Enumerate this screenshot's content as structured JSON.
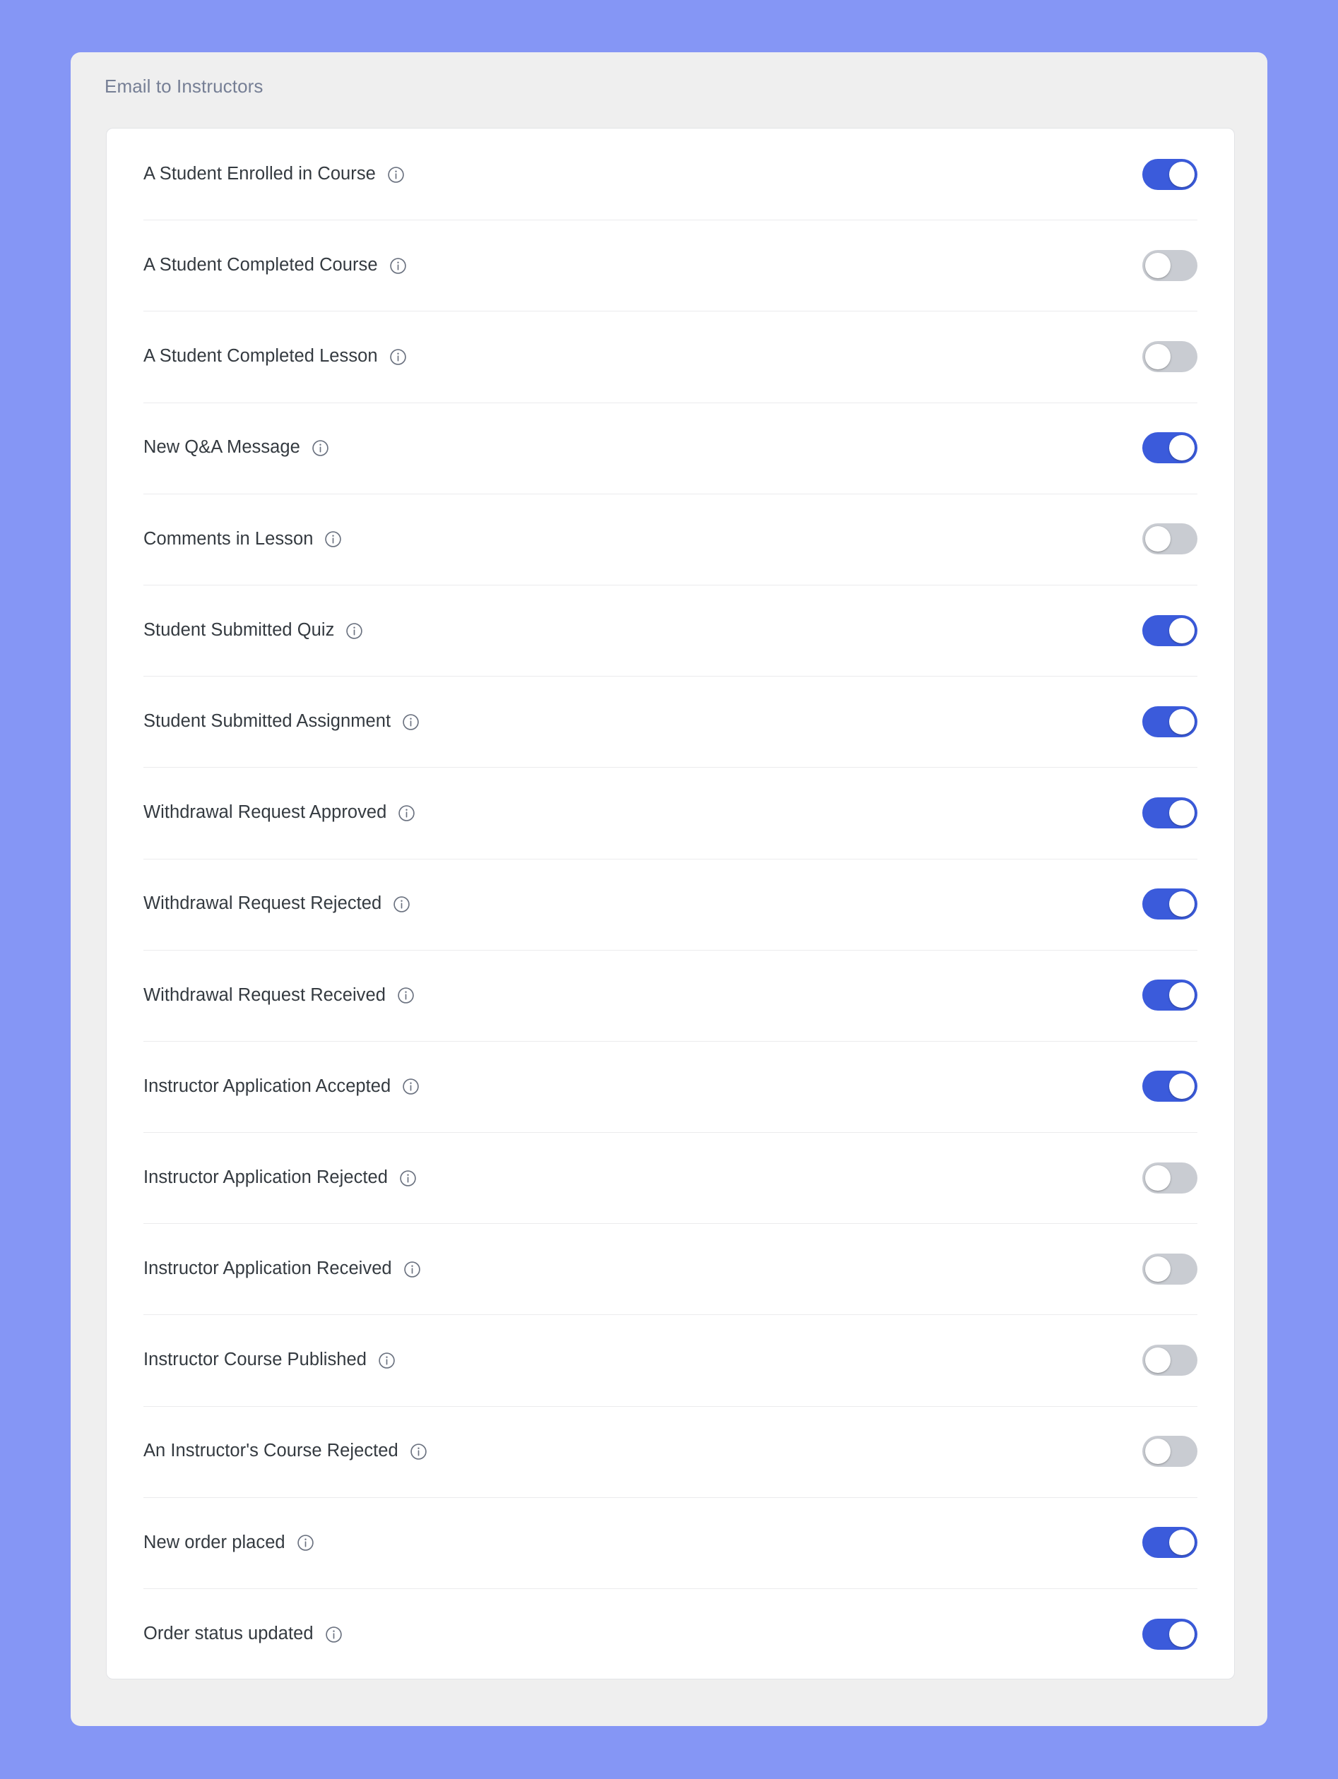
{
  "theme": {
    "page_background": "#8596F5",
    "panel_background": "#EFEFEF",
    "card_background": "#FFFFFF",
    "toggle_on_color": "#3B5BDB",
    "toggle_off_color": "#C9CCD2",
    "label_color": "#343A40",
    "header_color": "#767F95",
    "divider_color": "#EBEBED"
  },
  "section": {
    "title": "Email to Instructors"
  },
  "icons": {
    "info": "info-circle-icon"
  },
  "settings": [
    {
      "label": "A Student Enrolled in Course",
      "enabled": true,
      "state_text": "On"
    },
    {
      "label": "A Student Completed Course",
      "enabled": false,
      "state_text": "Off"
    },
    {
      "label": "A Student Completed Lesson",
      "enabled": false,
      "state_text": "Off"
    },
    {
      "label": "New Q&A Message",
      "enabled": true,
      "state_text": "On"
    },
    {
      "label": "Comments in Lesson",
      "enabled": false,
      "state_text": "Off"
    },
    {
      "label": "Student Submitted Quiz",
      "enabled": true,
      "state_text": "On"
    },
    {
      "label": "Student Submitted Assignment",
      "enabled": true,
      "state_text": "On"
    },
    {
      "label": "Withdrawal Request Approved",
      "enabled": true,
      "state_text": "On"
    },
    {
      "label": "Withdrawal Request Rejected",
      "enabled": true,
      "state_text": "On"
    },
    {
      "label": "Withdrawal Request Received",
      "enabled": true,
      "state_text": "On"
    },
    {
      "label": "Instructor Application Accepted",
      "enabled": true,
      "state_text": "On"
    },
    {
      "label": "Instructor Application Rejected",
      "enabled": false,
      "state_text": "Off"
    },
    {
      "label": "Instructor Application Received",
      "enabled": false,
      "state_text": "Off"
    },
    {
      "label": "Instructor Course Published",
      "enabled": false,
      "state_text": "Off"
    },
    {
      "label": "An Instructor's Course Rejected",
      "enabled": false,
      "state_text": "Off"
    },
    {
      "label": "New order placed",
      "enabled": true,
      "state_text": "On"
    },
    {
      "label": "Order status updated",
      "enabled": true,
      "state_text": "On"
    }
  ]
}
